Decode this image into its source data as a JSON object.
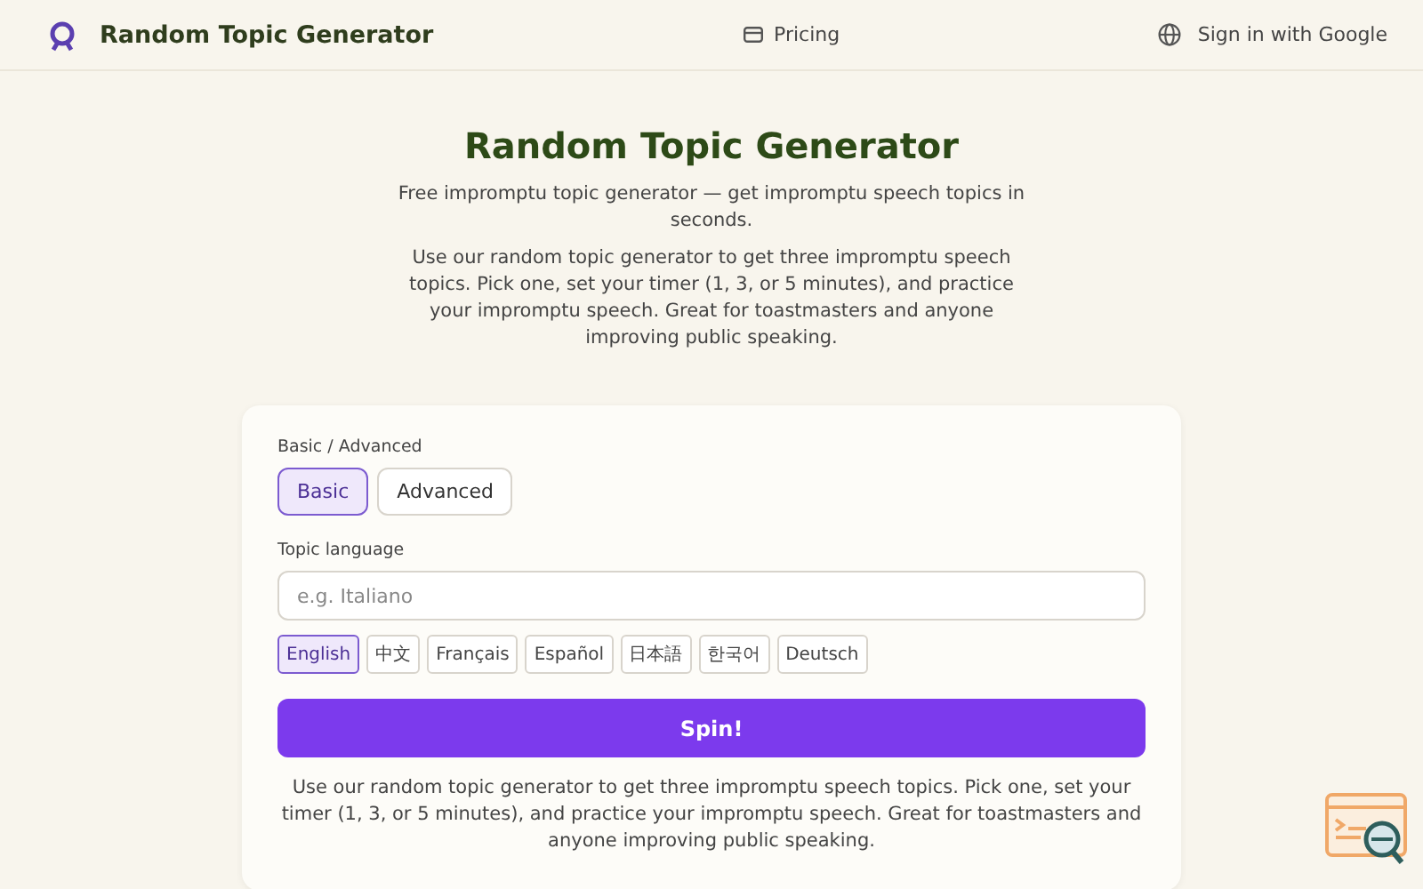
{
  "header": {
    "brand": "Random Topic Generator",
    "nav": [
      {
        "kind": "pricing",
        "label": "Pricing"
      },
      {
        "kind": "signin",
        "label": "Sign in with Google"
      }
    ]
  },
  "hero": {
    "title": "Random Topic Generator",
    "subtitle": "Free impromptu topic generator — get impromptu speech topics in seconds.",
    "description": "Use our random topic generator to get three impromptu speech topics. Pick one, set your timer (1, 3, or 5 minutes), and practice your impromptu speech. Great for toastmasters and anyone improving public speaking."
  },
  "card": {
    "mode_label": "Basic / Advanced",
    "modes": [
      {
        "label": "Basic",
        "selected": true
      },
      {
        "label": "Advanced",
        "selected": false
      }
    ],
    "language_label": "Topic language",
    "language_field": {
      "placeholder": "e.g. Italiano"
    },
    "languages": [
      {
        "label": "English",
        "selected": true
      },
      {
        "label": "中文",
        "selected": false
      },
      {
        "label": "Français",
        "selected": false
      },
      {
        "label": "Español",
        "selected": false
      },
      {
        "label": "日本語",
        "selected": false
      },
      {
        "label": "한국어",
        "selected": false
      },
      {
        "label": "Deutsch",
        "selected": false
      }
    ],
    "spin_button": "Spin!",
    "footer_text": "Use our random topic generator to get three impromptu speech topics. Pick one, set your timer (1, 3, or 5 minutes), and practice your impromptu speech. Great for toastmasters and anyone improving public speaking."
  }
}
